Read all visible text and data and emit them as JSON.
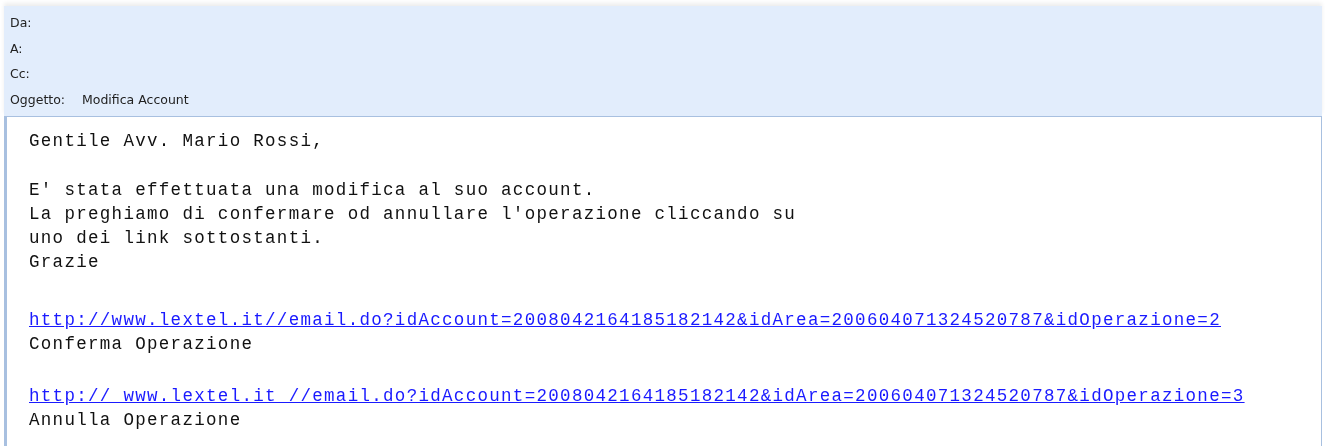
{
  "header": {
    "fields": [
      {
        "label": "Da:"
      },
      {
        "label": "A:"
      },
      {
        "label": "Cc:"
      },
      {
        "label": "Oggetto:",
        "value": "Modifica Account"
      }
    ]
  },
  "body": {
    "greeting": "Gentile Avv. Mario Rossi,",
    "message": "E' stata effettuata una modifica al suo account.\nLa preghiamo di confermare od annullare l'operazione cliccando su\nuno dei link sottostanti.\nGrazie",
    "actions": [
      {
        "url": "http://www.lextel.it//email.do?idAccount=2008042164185182142&idArea=200604071324520787&idOperazione=2",
        "caption": "Conferma Operazione"
      },
      {
        "url": "http:// www.lextel.it //email.do?idAccount=2008042164185182142&idArea=200604071324520787&idOperazione=3",
        "caption": "Annulla Operazione"
      }
    ]
  }
}
